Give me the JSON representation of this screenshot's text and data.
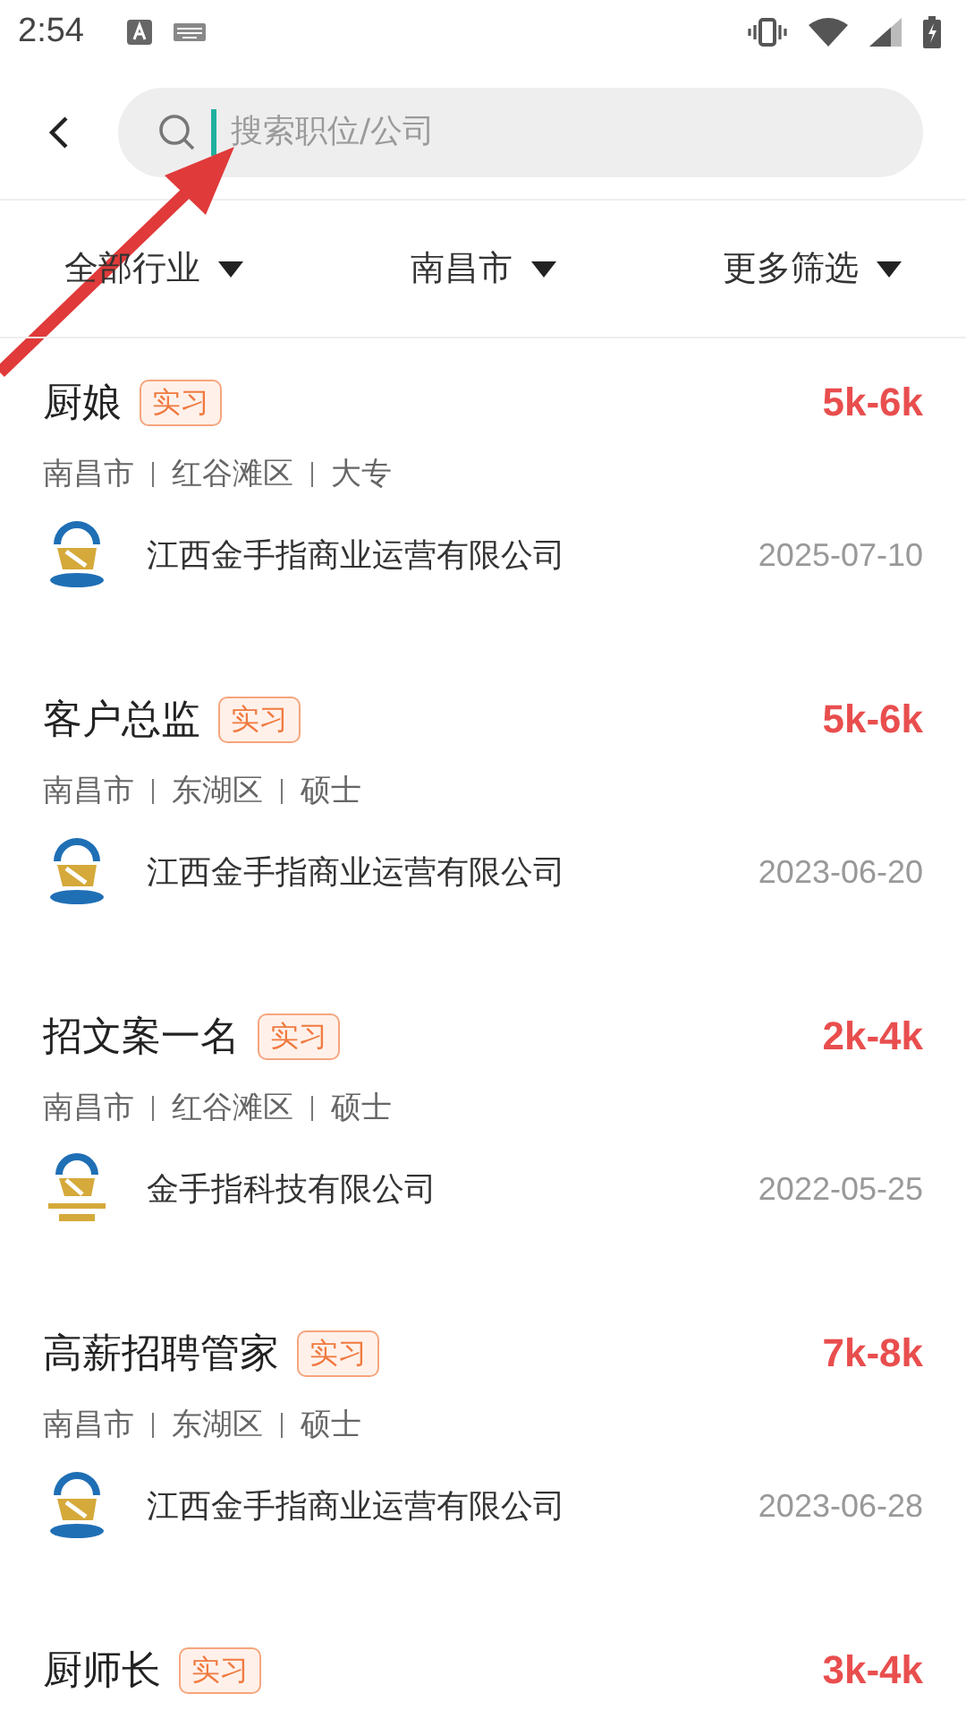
{
  "status_bar": {
    "time": "2:54"
  },
  "search": {
    "placeholder": "搜索职位/公司"
  },
  "filters": [
    {
      "label": "全部行业"
    },
    {
      "label": "南昌市"
    },
    {
      "label": "更多筛选"
    }
  ],
  "jobs": [
    {
      "title": "厨娘",
      "tag": "实习",
      "salary": "5k-6k",
      "location": [
        "南昌市",
        "红谷滩区",
        "大专"
      ],
      "logo": {
        "kind": "seal"
      },
      "company": "江西金手指商业运营有限公司",
      "date": "2025-07-10"
    },
    {
      "title": "客户总监",
      "tag": "实习",
      "salary": "5k-6k",
      "location": [
        "南昌市",
        "东湖区",
        "硕士"
      ],
      "logo": {
        "kind": "seal"
      },
      "company": "江西金手指商业运营有限公司",
      "date": "2023-06-20"
    },
    {
      "title": "招文案一名",
      "tag": "实习",
      "salary": "2k-4k",
      "location": [
        "南昌市",
        "红谷滩区",
        "硕士"
      ],
      "logo": {
        "kind": "wordmark"
      },
      "company": "金手指科技有限公司",
      "date": "2022-05-25"
    },
    {
      "title": "高薪招聘管家",
      "tag": "实习",
      "salary": "7k-8k",
      "location": [
        "南昌市",
        "东湖区",
        "硕士"
      ],
      "logo": {
        "kind": "seal"
      },
      "company": "江西金手指商业运营有限公司",
      "date": "2023-06-28"
    },
    {
      "title": "厨师长",
      "tag": "实习",
      "salary": "3k-4k"
    }
  ]
}
